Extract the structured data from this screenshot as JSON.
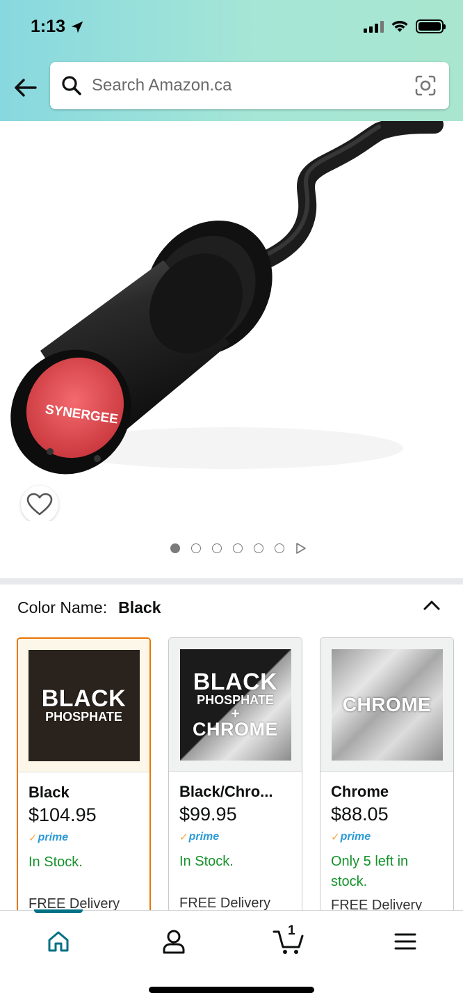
{
  "status_bar": {
    "time": "1:13"
  },
  "search": {
    "placeholder": "Search Amazon.ca"
  },
  "product": {
    "brand_on_image": "SYNERGEE",
    "image_count": 6,
    "active_image_index": 0
  },
  "variation": {
    "label": "Color Name:",
    "selected": "Black"
  },
  "options": [
    {
      "name": "Black",
      "price": "$104.95",
      "prime": "prime",
      "stock": "In Stock.",
      "delivery": "FREE Delivery",
      "swatch_lines": [
        "BLACK",
        "PHOSPHATE"
      ]
    },
    {
      "name": "Black/Chro...",
      "price": "$99.95",
      "prime": "prime",
      "stock": "In Stock.",
      "delivery": "FREE Delivery",
      "swatch_lines": [
        "BLACK",
        "PHOSPHATE",
        "+",
        "CHROME"
      ]
    },
    {
      "name": "Chrome",
      "price": "$88.05",
      "prime": "prime",
      "stock": "Only 5 left in stock.",
      "delivery": "FREE Delivery",
      "swatch_lines": [
        "CHROME"
      ]
    }
  ],
  "bottom_nav": {
    "cart_count": "1",
    "items": [
      "home-icon",
      "account-icon",
      "cart-icon",
      "menu-icon"
    ],
    "active": "home"
  },
  "colors": {
    "accent": "#007185",
    "selected_border": "#e77600",
    "stock_green": "#15912a",
    "prime_blue": "#2b9ad6"
  }
}
